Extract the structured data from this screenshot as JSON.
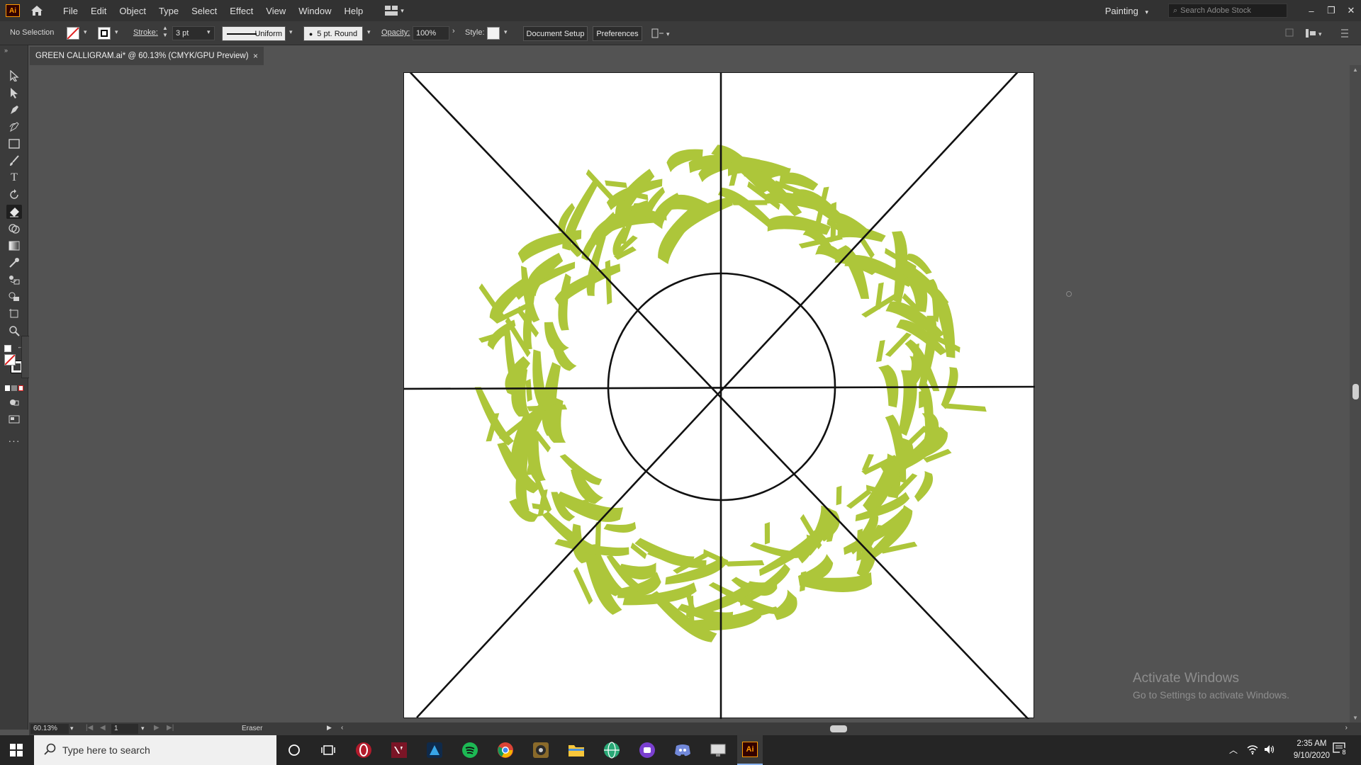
{
  "app": {
    "logo_text": "Ai"
  },
  "menu": [
    "File",
    "Edit",
    "Object",
    "Type",
    "Select",
    "Effect",
    "View",
    "Window",
    "Help"
  ],
  "workspace": "Painting",
  "search_placeholder": "Search Adobe Stock",
  "window_controls": [
    "–",
    "❐",
    "✕"
  ],
  "control_bar": {
    "selection": "No Selection",
    "stroke_label": "Stroke:",
    "stroke_value": "3 pt",
    "stroke_profile": "Uniform",
    "brush": "5 pt. Round",
    "opacity_label": "Opacity:",
    "opacity_value": "100%",
    "style_label": "Style:",
    "document_setup": "Document Setup",
    "preferences": "Preferences"
  },
  "document_tab": {
    "title": "GREEN CALLIGRAM.ai* @ 60.13% (CMYK/GPU Preview)",
    "close": "×"
  },
  "status": {
    "zoom": "60.13%",
    "artboard": "1",
    "tool": "Eraser"
  },
  "artwork": {
    "fill_color": "#adc63a",
    "guide_color": "#111111"
  },
  "watermark": {
    "line1": "Activate Windows",
    "line2": "Go to Settings to activate Windows."
  },
  "taskbar": {
    "search_placeholder": "Type here to search",
    "time": "2:35 AM",
    "date": "9/10/2020",
    "notification_count": "8"
  }
}
